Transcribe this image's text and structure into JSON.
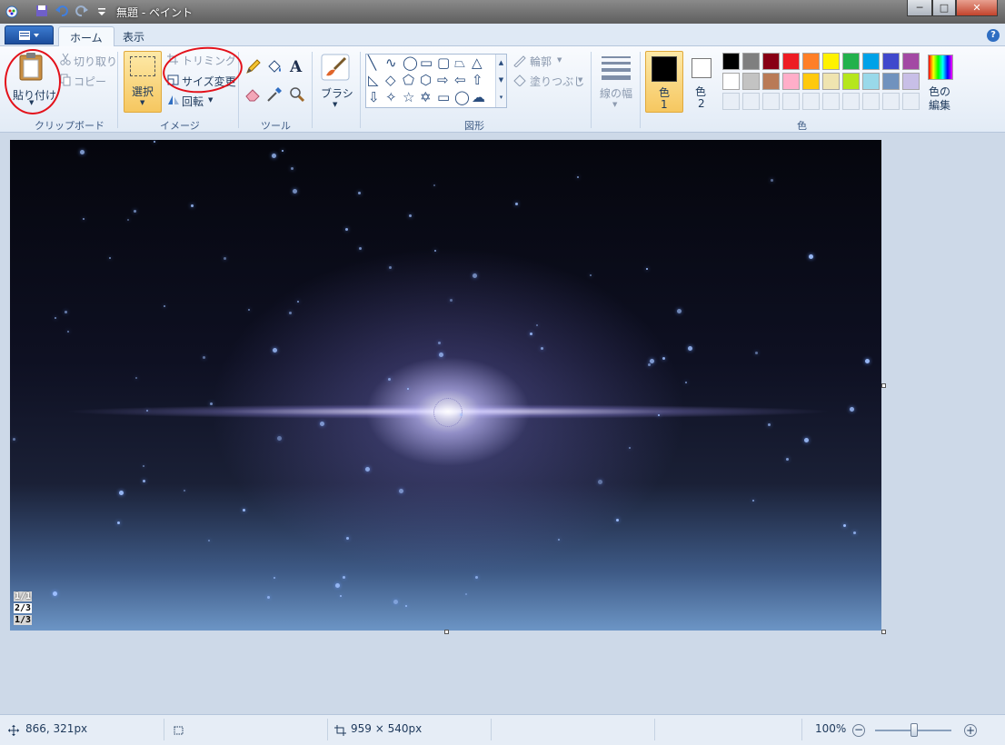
{
  "window": {
    "title": "無題 - ペイント",
    "minimize": "─",
    "maximize": "□",
    "close": "✕"
  },
  "tabs": [
    {
      "label": "ホーム"
    },
    {
      "label": "表示"
    }
  ],
  "clipboard": {
    "paste": "貼り付け",
    "cut": "切り取り",
    "copy": "コピー",
    "group": "クリップボード"
  },
  "image": {
    "select": "選択",
    "crop": "トリミング",
    "resize": "サイズ変更",
    "rotate": "回転",
    "group": "イメージ"
  },
  "tools": {
    "group": "ツール"
  },
  "brushes": {
    "label": "ブラシ"
  },
  "shapes": {
    "outline": "輪郭",
    "fill": "塗りつぶし",
    "group": "図形"
  },
  "linewidth": {
    "label": "線の幅"
  },
  "colors": {
    "color1": "色",
    "color1_num": "1",
    "color2": "色",
    "color2_num": "2",
    "edit_line1": "色の",
    "edit_line2": "編集",
    "group": "色",
    "color1_value": "#000000",
    "color2_value": "#ffffff",
    "palette_row1": [
      "#000000",
      "#7f7f7f",
      "#880015",
      "#ed1c24",
      "#ff7f27",
      "#fff200",
      "#22b14c",
      "#00a2e8",
      "#3f48cc",
      "#a349a4"
    ],
    "palette_row2": [
      "#ffffff",
      "#c3c3c3",
      "#b97a57",
      "#ffaec9",
      "#ffc90e",
      "#efe4b0",
      "#b5e61d",
      "#99d9ea",
      "#7092be",
      "#c8bfe7"
    ]
  },
  "canvas": {
    "pager": [
      "1/1",
      "2/3",
      "1/3"
    ]
  },
  "status": {
    "cursor": "866, 321px",
    "size": "959 × 540px",
    "zoom": "100%"
  }
}
